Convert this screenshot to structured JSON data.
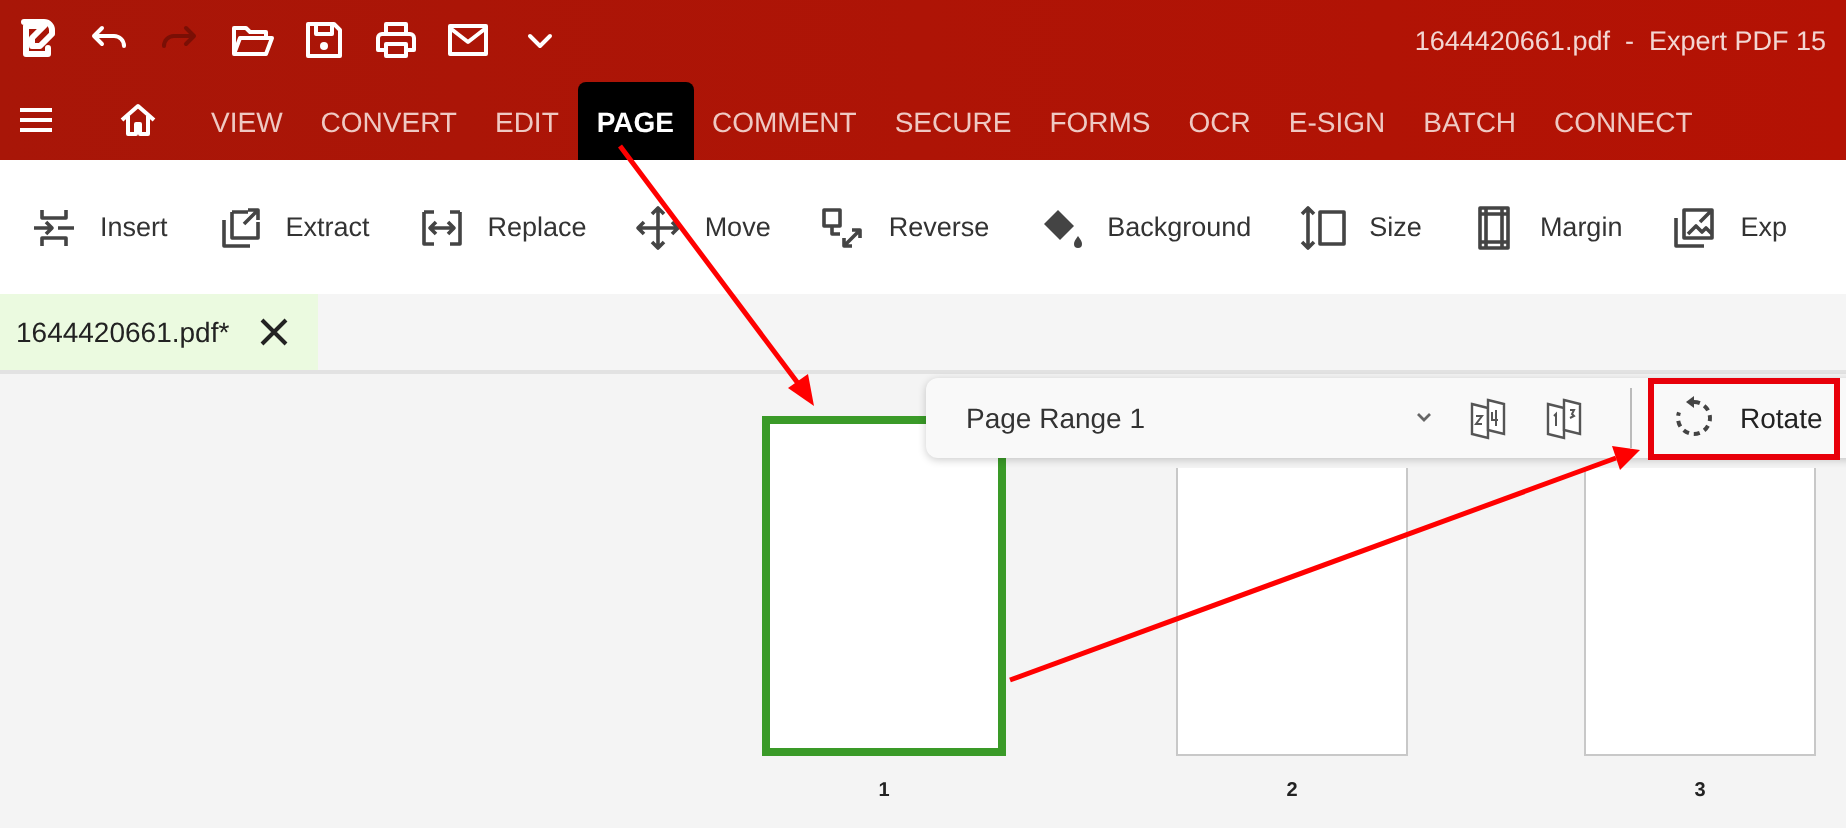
{
  "window": {
    "title": "1644420661.pdf  -  Expert PDF 15"
  },
  "menu_tabs": [
    {
      "label": "VIEW",
      "selected": false
    },
    {
      "label": "CONVERT",
      "selected": false
    },
    {
      "label": "EDIT",
      "selected": false
    },
    {
      "label": "PAGE",
      "selected": true
    },
    {
      "label": "COMMENT",
      "selected": false
    },
    {
      "label": "SECURE",
      "selected": false
    },
    {
      "label": "FORMS",
      "selected": false
    },
    {
      "label": "OCR",
      "selected": false
    },
    {
      "label": "E-SIGN",
      "selected": false
    },
    {
      "label": "BATCH",
      "selected": false
    },
    {
      "label": "CONNECT",
      "selected": false
    }
  ],
  "ribbon": [
    {
      "label": "Insert",
      "kind": "insert"
    },
    {
      "label": "Extract",
      "kind": "extract"
    },
    {
      "label": "Replace",
      "kind": "replace"
    },
    {
      "label": "Move",
      "kind": "move"
    },
    {
      "label": "Reverse",
      "kind": "reverse"
    },
    {
      "label": "Background",
      "kind": "background"
    },
    {
      "label": "Size",
      "kind": "size"
    },
    {
      "label": "Margin",
      "kind": "margin"
    },
    {
      "label": "Exp",
      "kind": "export"
    }
  ],
  "document_tabs": [
    {
      "label": "1644420661.pdf*",
      "selected": true
    }
  ],
  "page_toolbar": {
    "range": "Page Range 1",
    "rotate": {
      "label": "Rotate",
      "highlighted": true
    }
  },
  "pages": [
    {
      "label": "1",
      "selected": true
    },
    {
      "label": "2",
      "selected": false
    },
    {
      "label": "3",
      "selected": false
    }
  ]
}
